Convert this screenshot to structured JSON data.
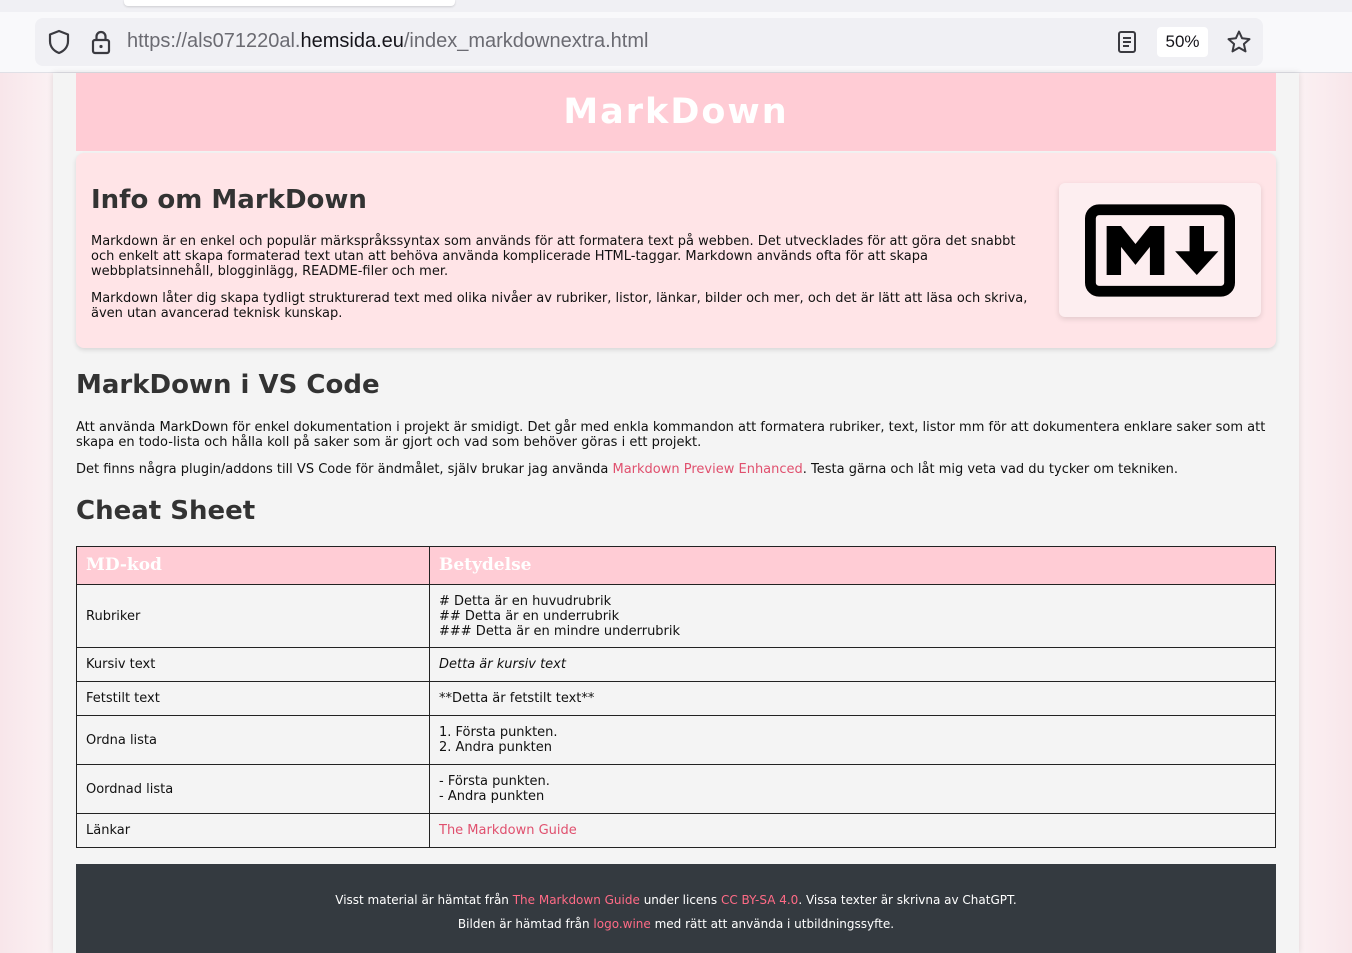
{
  "browser": {
    "url_prefix": "https://als071220al.",
    "url_domain": "hemsida.eu",
    "url_path": "/index_markdownextra.html",
    "zoom": "50%",
    "icons": [
      "shield-icon",
      "lock-icon",
      "reader-view-icon",
      "bookmark-star-icon"
    ]
  },
  "header": {
    "title": "MarkDown"
  },
  "info": {
    "heading": "Info om MarkDown",
    "p1": "Markdown är en enkel och populär märkspråkssyntax som används för att formatera text på webben. Det utvecklades för att göra det snabbt och enkelt att skapa formaterad text utan att behöva använda komplicerade HTML-taggar. Markdown används ofta för att skapa webbplatsinnehåll, blogginlägg, README-filer och mer.",
    "p2": "Markdown låter dig skapa tydligt strukturerad text med olika nivåer av rubriker, listor, länkar, bilder och mer, och det är lätt att läsa och skriva, även utan avancerad teknisk kunskap.",
    "logo_icon": "markdown-logo"
  },
  "vscode": {
    "heading": "MarkDown i VS Code",
    "p1": "Att använda MarkDown för enkel dokumentation i projekt är smidigt. Det går med enkla kommandon att formatera rubriker, text, listor mm för att dokumentera enklare saker som att skapa en todo-lista och hålla koll på saker som är gjort och vad som behöver göras i ett projekt.",
    "p2_before": "Det finns några plugin/addons till VS Code för ändmålet, själv brukar jag använda ",
    "p2_link": "Markdown Preview Enhanced",
    "p2_after": ". Testa gärna och låt mig veta vad du tycker om tekniken."
  },
  "cheatsheet": {
    "heading": "Cheat Sheet",
    "col1": "MD-kod",
    "col2": "Betydelse",
    "rows": [
      {
        "label": "Rubriker",
        "lines": [
          "# Detta är en huvudrubrik",
          "## Detta är en underrubrik",
          "### Detta är en mindre underrubrik"
        ]
      },
      {
        "label": "Kursiv text",
        "text": "Detta är kursiv text"
      },
      {
        "label": "Fetstilt text",
        "text": "**Detta är fetstilt text**"
      },
      {
        "label": "Ordna lista",
        "lines": [
          "1. Första punkten.",
          "2. Andra punkten"
        ]
      },
      {
        "label": "Oordnad lista",
        "lines": [
          "- Första punkten.",
          "- Andra punkten"
        ]
      },
      {
        "label": "Länkar",
        "link": "The Markdown Guide"
      }
    ]
  },
  "footer": {
    "l1_a": "Visst material är hämtat från ",
    "l1_link1": "The Markdown Guide",
    "l1_b": " under licens ",
    "l1_link2": "CC BY-SA 4.0",
    "l1_c": ". Vissa texter är skrivna av ChatGPT.",
    "l2_a": "Bilden är hämtad från ",
    "l2_link": "logo.wine",
    "l2_b": " med rätt att använda i utbildningssyfte."
  },
  "colors": {
    "header_pink": "#ffccd5",
    "card_pink": "#ffe4e7",
    "link": "#e0506e",
    "footer": "#343a40"
  }
}
